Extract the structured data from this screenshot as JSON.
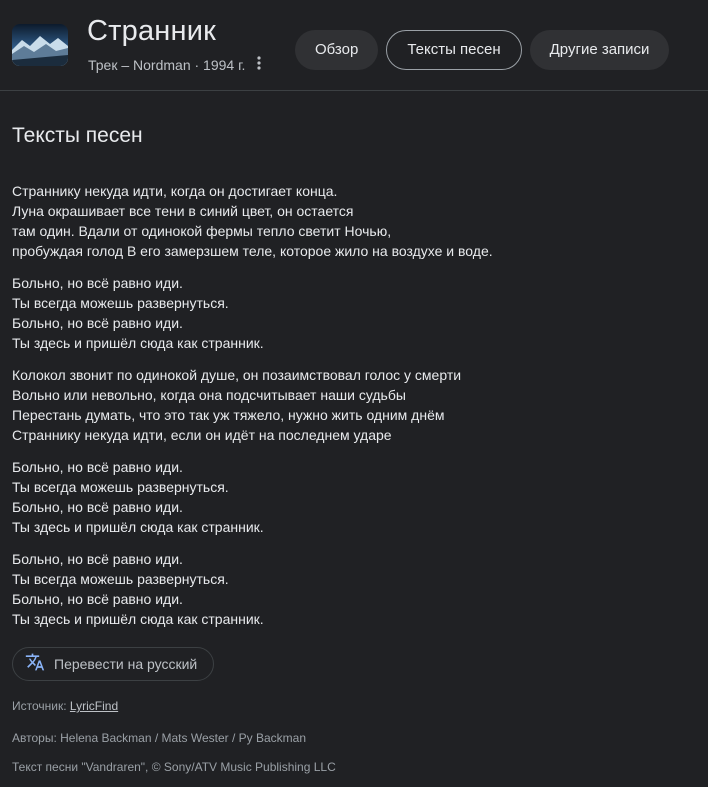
{
  "header": {
    "title": "Странник",
    "subtitle": "Трек – Nordman · 1994 г.",
    "more_icon": "more-vert-icon",
    "thumbnail": "album-art"
  },
  "tabs": [
    {
      "label": "Обзор",
      "active": false
    },
    {
      "label": "Тексты песен",
      "active": true
    },
    {
      "label": "Другие записи",
      "active": false
    }
  ],
  "section_title": "Тексты песен",
  "lyrics": {
    "stanzas": [
      [
        "Страннику некуда идти, когда он достигает конца.",
        "Луна окрашивает все тени в синий цвет, он остается",
        "там один. Вдали от одинокой фермы тепло светит Ночью,",
        "пробуждая голод В его замерзшем теле, которое жило на воздухе и воде."
      ],
      [
        "Больно, но всё равно иди.",
        "Ты всегда можешь развернуться.",
        "Больно, но всё равно иди.",
        "Ты здесь и пришёл сюда как странник."
      ],
      [
        "Колокол звонит по одинокой душе, он позаимствовал голос у смерти",
        "Вольно или невольно, когда она подсчитывает наши судьбы",
        "Перестань думать, что это так уж тяжело, нужно жить одним днём",
        "Страннику некуда идти, если он идёт на последнем ударе"
      ],
      [
        "Больно, но всё равно иди.",
        "Ты всегда можешь развернуться.",
        "Больно, но всё равно иди.",
        "Ты здесь и пришёл сюда как странник."
      ],
      [
        "Больно, но всё равно иди.",
        "Ты всегда можешь развернуться.",
        "Больно, но всё равно иди.",
        "Ты здесь и пришёл сюда как странник."
      ]
    ]
  },
  "translate_button": {
    "label": "Перевести на русский",
    "icon": "translate-icon",
    "icon_color": "#8ab4f8"
  },
  "source": {
    "prefix": "Источник: ",
    "link": "LyricFind"
  },
  "authors": "Авторы: Helena Backman / Mats Wester / Py Backman",
  "copyright": "Текст песни \"Vandraren\", © Sony/ATV Music Publishing LLC",
  "colors": {
    "background": "#202124",
    "tab_background": "#303134",
    "text": "#e8eaed",
    "muted_text": "#9aa0a6"
  }
}
